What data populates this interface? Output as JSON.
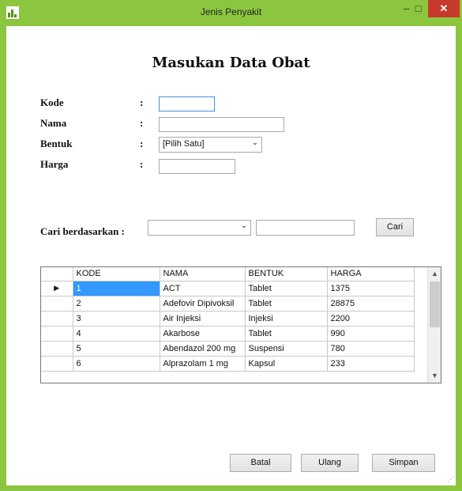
{
  "window": {
    "title": "Jenis Penyakit",
    "minimize_glyph": "–",
    "maximize_glyph": "□",
    "close_glyph": "✕"
  },
  "form": {
    "heading": "Masukan Data Obat",
    "kode_label": "Kode",
    "nama_label": "Nama",
    "bentuk_label": "Bentuk",
    "harga_label": "Harga",
    "colon": ":",
    "kode_value": "",
    "nama_value": "",
    "harga_value": "",
    "bentuk_selected": "[Pilih Satu]"
  },
  "search": {
    "label": "Cari berdasarkan :",
    "field_selected": "",
    "query": "",
    "button": "Cari"
  },
  "grid": {
    "columns": [
      "KODE",
      "NAMA",
      "BENTUK",
      "HARGA"
    ],
    "rows": [
      [
        "1",
        "ACT",
        "Tablet",
        "1375"
      ],
      [
        "2",
        "Adefovir Dipivoksil",
        "Tablet",
        "28875"
      ],
      [
        "3",
        "Air Injeksi",
        "Injeksi",
        "2200"
      ],
      [
        "4",
        "Akarbose",
        "Tablet",
        "990"
      ],
      [
        "5",
        "Abendazol 200 mg",
        "Suspensi",
        "780"
      ],
      [
        "6",
        "Alprazolam 1 mg",
        "Kapsul",
        "233"
      ]
    ],
    "current_row_marker": "▶"
  },
  "buttons": {
    "batal": "Batal",
    "ulang": "Ulang",
    "simpan": "Simpan"
  },
  "colors": {
    "titlebar": "#8cc63f",
    "close": "#c7392b",
    "selection": "#3399ff"
  }
}
